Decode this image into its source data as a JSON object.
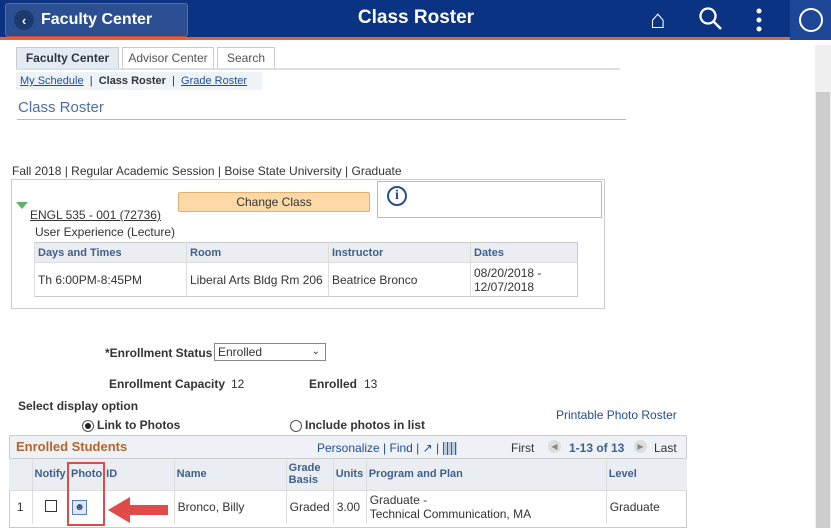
{
  "header": {
    "back_label": "Faculty Center",
    "title": "Class Roster",
    "icons": [
      "home-icon",
      "search-icon",
      "more-vertical-icon",
      "navbar-compass-icon"
    ],
    "color": "#0b3383",
    "accent": "#e0652f"
  },
  "tabs": [
    {
      "label": "Faculty Center",
      "active": true
    },
    {
      "label": "Advisor Center"
    },
    {
      "label": "Search"
    }
  ],
  "sublinks": [
    {
      "label": "My Schedule"
    },
    {
      "label": "Class Roster",
      "current": true
    },
    {
      "label": "Grade Roster"
    }
  ],
  "page_title": "Class Roster",
  "term": "Fall 2018 | Regular Academic Session | Boise State University | Graduate",
  "class": {
    "link": "ENGL 535 - 001 (72736)",
    "description": "User Experience (Lecture)",
    "change_button": "Change Class",
    "meeting_headers": [
      "Days and Times",
      "Room",
      "Instructor",
      "Dates"
    ],
    "meeting_row": [
      "Th 6:00PM-8:45PM",
      "Liberal Arts Bldg Rm 206",
      "Beatrice Bronco",
      "08/20/2018 - 12/07/2018"
    ]
  },
  "enrollment": {
    "status_label": "*Enrollment Status",
    "status_value": "Enrolled",
    "capacity_label": "Enrollment Capacity",
    "capacity": "12",
    "enrolled_label": "Enrolled",
    "enrolled": "13"
  },
  "display": {
    "label": "Select display option",
    "opt1": "Link to Photos",
    "opt2": "Include photos in list",
    "selected": "Link to Photos",
    "printable": "Printable Photo Roster"
  },
  "grid": {
    "title": "Enrolled Students",
    "personalize": "Personalize",
    "find": "Find",
    "first": "First",
    "range": "1-13 of 13",
    "last": "Last",
    "headers": [
      "Notify",
      "Photo",
      "ID",
      "Name",
      "Grade Basis",
      "Units",
      "Program and Plan",
      "Level"
    ],
    "rows": [
      {
        "num": "1",
        "name": "Bronco, Billy",
        "grade_basis": "Graded",
        "units": "3.00",
        "program": "Graduate -",
        "plan": "Technical Communication, MA",
        "level": "Graduate"
      }
    ]
  },
  "annotation_color": "#e24a4a"
}
